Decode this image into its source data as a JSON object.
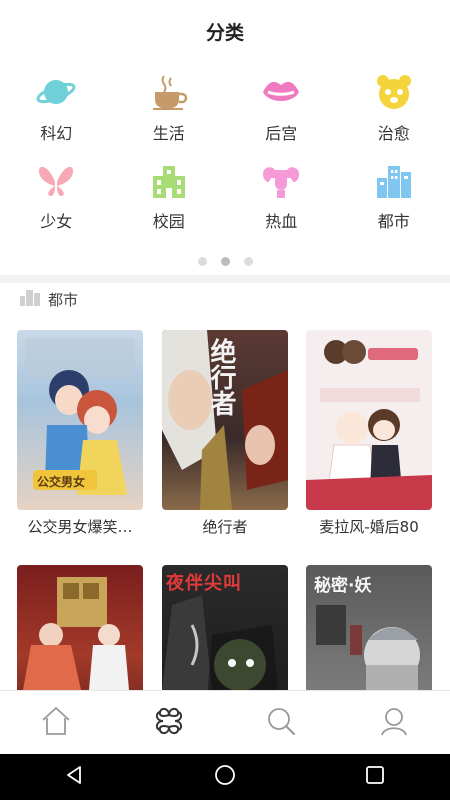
{
  "header": {
    "title": "分类"
  },
  "categories": [
    {
      "label": "科幻",
      "icon": "planet-icon",
      "color": "#6fd0d8"
    },
    {
      "label": "生活",
      "icon": "coffee-cup-icon",
      "color": "#c79a6b"
    },
    {
      "label": "后宫",
      "icon": "lips-icon",
      "color": "#f07ac0"
    },
    {
      "label": "治愈",
      "icon": "bear-face-icon",
      "color": "#f5d33b"
    },
    {
      "label": "少女",
      "icon": "butterfly-icon",
      "color": "#f7a8b5"
    },
    {
      "label": "校园",
      "icon": "school-building-icon",
      "color": "#a8dd76"
    },
    {
      "label": "热血",
      "icon": "muscle-arm-icon",
      "color": "#f59ad6"
    },
    {
      "label": "都市",
      "icon": "city-buildings-icon",
      "color": "#7fc6f0"
    }
  ],
  "pager": {
    "total": 3,
    "active": 2
  },
  "section": {
    "label": "都市"
  },
  "books": [
    {
      "name": "公交男女爆笑…"
    },
    {
      "name": "绝行者"
    },
    {
      "name": "麦拉风-婚后80"
    },
    {
      "name": ""
    },
    {
      "name": ""
    },
    {
      "name": ""
    }
  ],
  "cover_text": {
    "b1": "公交男女",
    "b2": "绝行者",
    "b5": "夜伴尖叫",
    "b6": "秘密·妖"
  },
  "tabbar": [
    {
      "icon": "home-icon"
    },
    {
      "icon": "category-icon"
    },
    {
      "icon": "search-icon"
    },
    {
      "icon": "profile-icon"
    }
  ],
  "system_nav": [
    {
      "icon": "back-triangle-icon"
    },
    {
      "icon": "home-circle-icon"
    },
    {
      "icon": "recent-square-icon"
    }
  ]
}
